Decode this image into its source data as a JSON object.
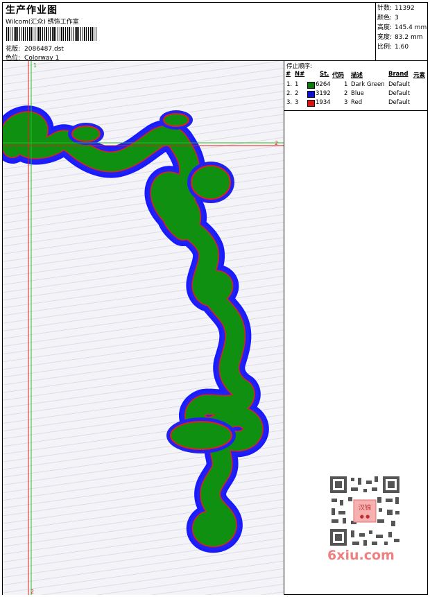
{
  "header": {
    "title": "生产作业图",
    "company": "Wilcom(汇众) 绣饰工作室",
    "design_label": "花版:",
    "design_value": "2086487.dst",
    "colorway_label": "色位:",
    "colorway_value": "Colorway 1"
  },
  "stats": [
    {
      "label": "针数:",
      "value": "11392"
    },
    {
      "label": "颜色:",
      "value": "3"
    },
    {
      "label": "高度:",
      "value": "145.4 mm"
    },
    {
      "label": "宽度:",
      "value": "83.2 mm"
    },
    {
      "label": "比例:",
      "value": "1.60"
    }
  ],
  "stop_sequence": {
    "title": "停止顺序:",
    "headers": [
      "#",
      "N#",
      "St.",
      "代码",
      "描述",
      "Brand",
      "元素"
    ],
    "rows": [
      {
        "num": "1.",
        "n": "1",
        "color": "#0a7a0a",
        "stitches": "6264",
        "code": "1",
        "desc": "Dark Green",
        "brand": "Default"
      },
      {
        "num": "2.",
        "n": "2",
        "color": "#1010d0",
        "stitches": "3192",
        "code": "2",
        "desc": "Blue",
        "brand": "Default"
      },
      {
        "num": "3.",
        "n": "3",
        "color": "#e01010",
        "stitches": "1934",
        "code": "3",
        "desc": "Red",
        "brand": "Default"
      }
    ]
  },
  "guides": {
    "marker_top": "1",
    "marker_right": "2",
    "marker_bottom": "2"
  },
  "watermark": {
    "text": "6xiu.com",
    "qr_center": "汉锦"
  },
  "colors": {
    "fill": "#109010",
    "outline_blue": "#1a1aff",
    "outline_red": "#e02020",
    "guide_red": "#e02020",
    "guide_green": "#20c020"
  }
}
